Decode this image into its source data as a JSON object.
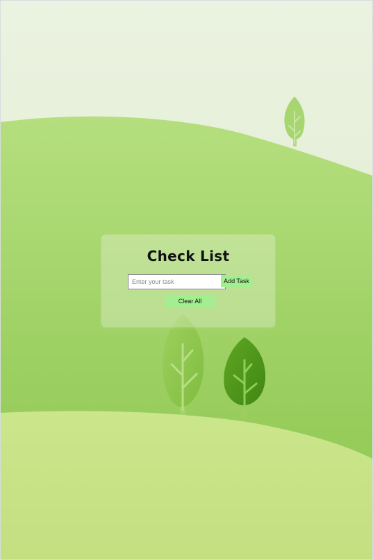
{
  "app": {
    "title": "Check List"
  },
  "task_form": {
    "input_value": "",
    "input_placeholder": "Enter your task",
    "add_label": "Add Task"
  },
  "actions": {
    "clear_label": "Clear All"
  },
  "colors": {
    "button_bg": "#a3ef8f",
    "sky": "#e4efd3",
    "hill_back": "#9bd262",
    "hill_front": "#c3e17f",
    "leaf_dark": "#4f9a18"
  },
  "background": {
    "icon": "green-hills-and-trees-illustration"
  }
}
